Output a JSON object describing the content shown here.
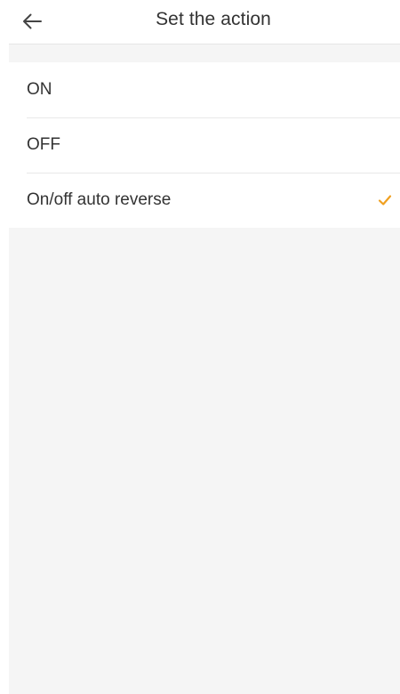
{
  "header": {
    "title": "Set the action",
    "back_icon": "arrow-left-icon"
  },
  "options": {
    "items": [
      {
        "label": "ON",
        "selected": false
      },
      {
        "label": "OFF",
        "selected": false
      },
      {
        "label": "On/off auto reverse",
        "selected": true
      }
    ]
  },
  "colors": {
    "accent_check": "#f0a020",
    "background": "#f5f5f5",
    "text": "#333333"
  }
}
